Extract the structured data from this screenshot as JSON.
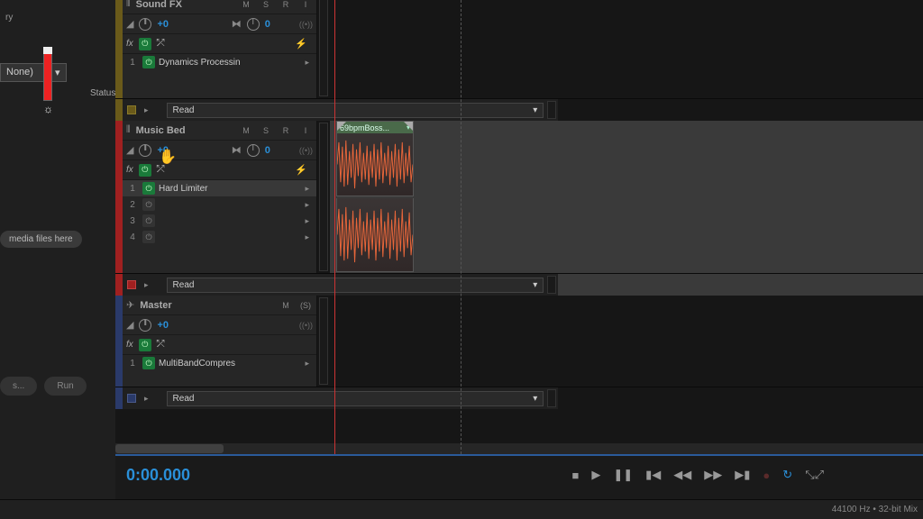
{
  "left": {
    "ry": "ry",
    "none": "None)",
    "status": "Status:",
    "media_hint": "media files here",
    "btn1": "s...",
    "btn2": "Run"
  },
  "tracks": [
    {
      "color": "yellow",
      "name": "Sound FX",
      "msri": [
        "M",
        "S",
        "R",
        "I"
      ],
      "vol": "+0",
      "pan": "0",
      "fx_slots": [
        {
          "n": "1",
          "on": true,
          "name": "Dynamics Processin"
        }
      ],
      "automation": "Read"
    },
    {
      "color": "red",
      "name": "Music Bed",
      "msri": [
        "M",
        "S",
        "R",
        "I"
      ],
      "vol": "+0",
      "pan": "0",
      "fx_slots": [
        {
          "n": "1",
          "on": true,
          "name": "Hard Limiter",
          "sel": true
        },
        {
          "n": "2",
          "on": false,
          "name": ""
        },
        {
          "n": "3",
          "on": false,
          "name": ""
        },
        {
          "n": "4",
          "on": false,
          "name": ""
        }
      ],
      "automation": "Read",
      "clip_name": "69bpmBoss..."
    },
    {
      "color": "blue",
      "name": "Master",
      "msri": [
        "M",
        "(S)"
      ],
      "vol": "+0",
      "fx_slots": [
        {
          "n": "1",
          "on": true,
          "name": "MultiBandCompres"
        }
      ],
      "automation": "Read"
    }
  ],
  "transport": {
    "timecode": "0:00.000"
  },
  "status": "44100 Hz • 32-bit Mix"
}
